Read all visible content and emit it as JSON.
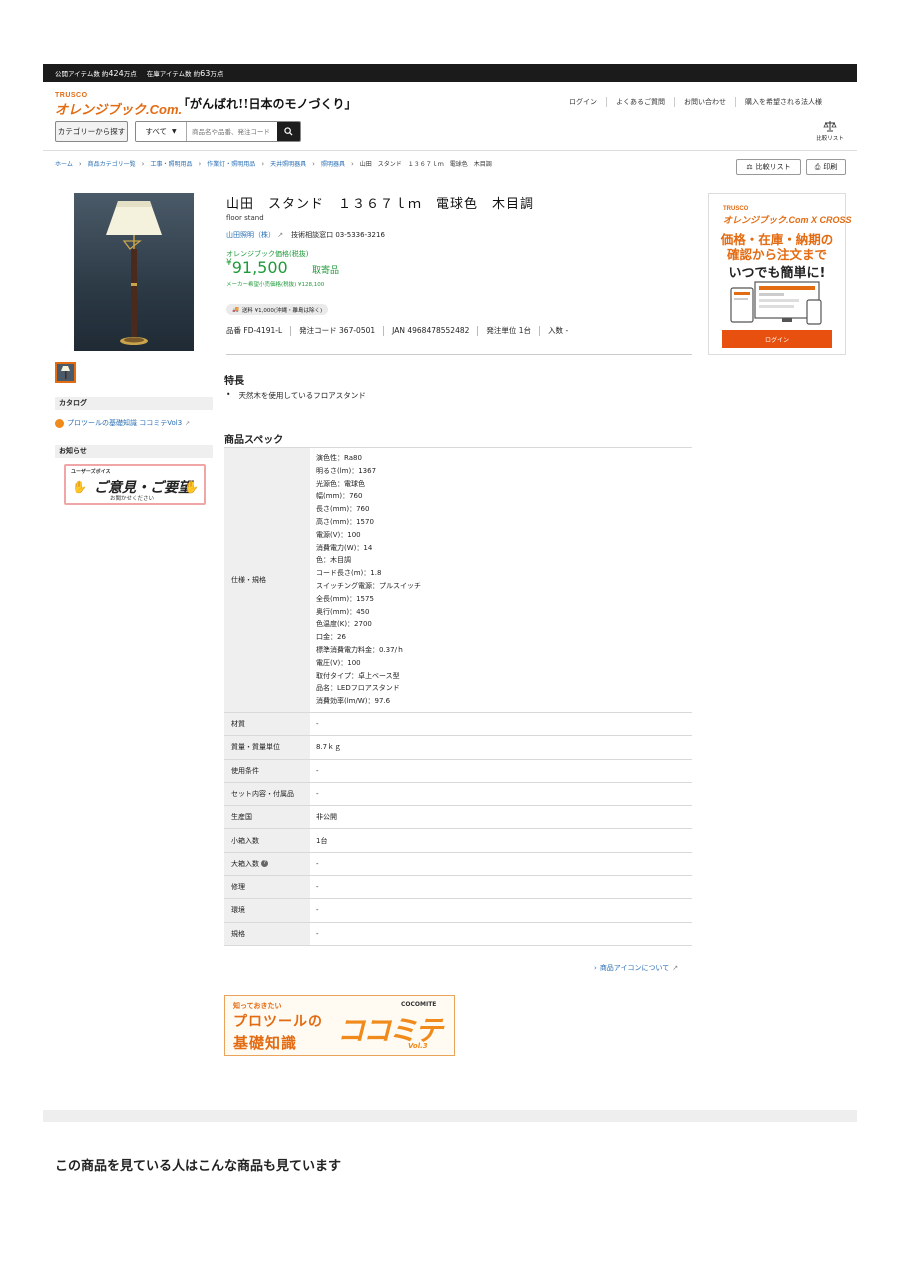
{
  "topbar": {
    "public_label": "公開アイテム数 約",
    "public_value": "424",
    "public_unit": "万点",
    "stock_label": "在庫アイテム数 約",
    "stock_value": "63",
    "stock_unit": "万点"
  },
  "header": {
    "logo_small": "TRUSCO",
    "logo_main": "オレンジブック.Com.",
    "slogan": "「がんばれ!!日本のモノづくり」",
    "nav": [
      "ログイン",
      "よくあるご質問",
      "お問い合わせ",
      "購入を希望される法人様"
    ],
    "category_button": "カテゴリーから探す",
    "search_select": "すべて",
    "search_placeholder": "商品名や品番、発注コード",
    "compare_list_label": "比較リスト"
  },
  "breadcrumb": [
    "ホーム",
    "商品カテゴリ一覧",
    "工事・照明用品",
    "作業灯・照明用品",
    "天井照明器具",
    "照明器具",
    "山田　スタンド　１３６７ｌｍ　電球色　木目調"
  ],
  "actions": {
    "compare": "比較リスト",
    "print": "印刷"
  },
  "product": {
    "title": "山田　スタンド　１３６７ｌｍ　電球色　木目調",
    "subtitle": "floor stand",
    "maker": "山田照明（株）",
    "consult": "技術相談窓口 03-5336-3216",
    "price_label": "オレンジブック価格(税抜)",
    "price_symbol": "¥",
    "price": "91,500",
    "availability": "取寄品",
    "msrp": "メーカー希望小売価格(税抜) ¥128,100",
    "shipping": "送料 ¥1,000(沖縄・離島は除く)",
    "codes": [
      "品番 FD-4191-L",
      "発注コード 367-0501",
      "JAN 4968478552482",
      "発注単位 1台",
      "入数 -"
    ]
  },
  "sidebar": {
    "catalog_heading": "カタログ",
    "catalog_link": "プロツールの基礎知識 ココミテVol3",
    "news_heading": "お知らせ",
    "voice_small": "ユーザーズボイス",
    "voice_main": "ご意見・ご要望",
    "voice_sub": "お聞かせください"
  },
  "ad": {
    "brand_small": "TRUSCO",
    "brand_main": "オレンジブック.Com X CROSS",
    "line1": "価格・在庫・納期の",
    "line2": "確認から注文まで",
    "line3": "いつでも簡単に!",
    "login": "ログイン"
  },
  "features": {
    "heading": "特長",
    "items": [
      "天然木を使用しているフロアスタンド"
    ]
  },
  "spec": {
    "heading": "商品スペック",
    "spec_key": "仕様・規格",
    "spec_lines": [
      "演色性：Ra80",
      "明るさ(lm)：1367",
      "光源色：電球色",
      "幅(mm)：760",
      "長さ(mm)：760",
      "高さ(mm)：1570",
      "電源(V)：100",
      "消費電力(W)：14",
      "色：木目調",
      "コード長さ(m)：1.8",
      "スイッチング電源：プルスイッチ",
      "全長(mm)：1575",
      "奥行(mm)：450",
      "色温度(K)：2700",
      "口金：26",
      "標準消費電力料金：0.37/ｈ",
      "電圧(V)：100",
      "取付タイプ：卓上ベース型",
      "品名：LEDフロアスタンド",
      "消費効率(lm/W)：97.6"
    ],
    "rows": [
      {
        "k": "材質",
        "v": "-"
      },
      {
        "k": "質量・質量単位",
        "v": "8.7ｋｇ"
      },
      {
        "k": "使用条件",
        "v": "-"
      },
      {
        "k": "セット内容・付属品",
        "v": "-"
      },
      {
        "k": "生産国",
        "v": "非公開"
      },
      {
        "k": "小箱入数",
        "v": "1台"
      },
      {
        "k": "大箱入数",
        "v": "-"
      },
      {
        "k": "修理",
        "v": "-"
      },
      {
        "k": "環境",
        "v": "-"
      },
      {
        "k": "規格",
        "v": "-"
      }
    ],
    "icon_link": "商品アイコンについて"
  },
  "banner": {
    "line1": "知っておきたい",
    "line2": "プロツールの",
    "line3": "基礎知識",
    "logo": "COCOMITE",
    "big": "ココミテ",
    "vol": "Vol.3"
  },
  "recommend_heading": "この商品を見ている人はこんな商品も見ています",
  "colors": {
    "brand_orange": "#e36b12",
    "price_green": "#1f9a3a",
    "link_blue": "#2a6fb5"
  }
}
